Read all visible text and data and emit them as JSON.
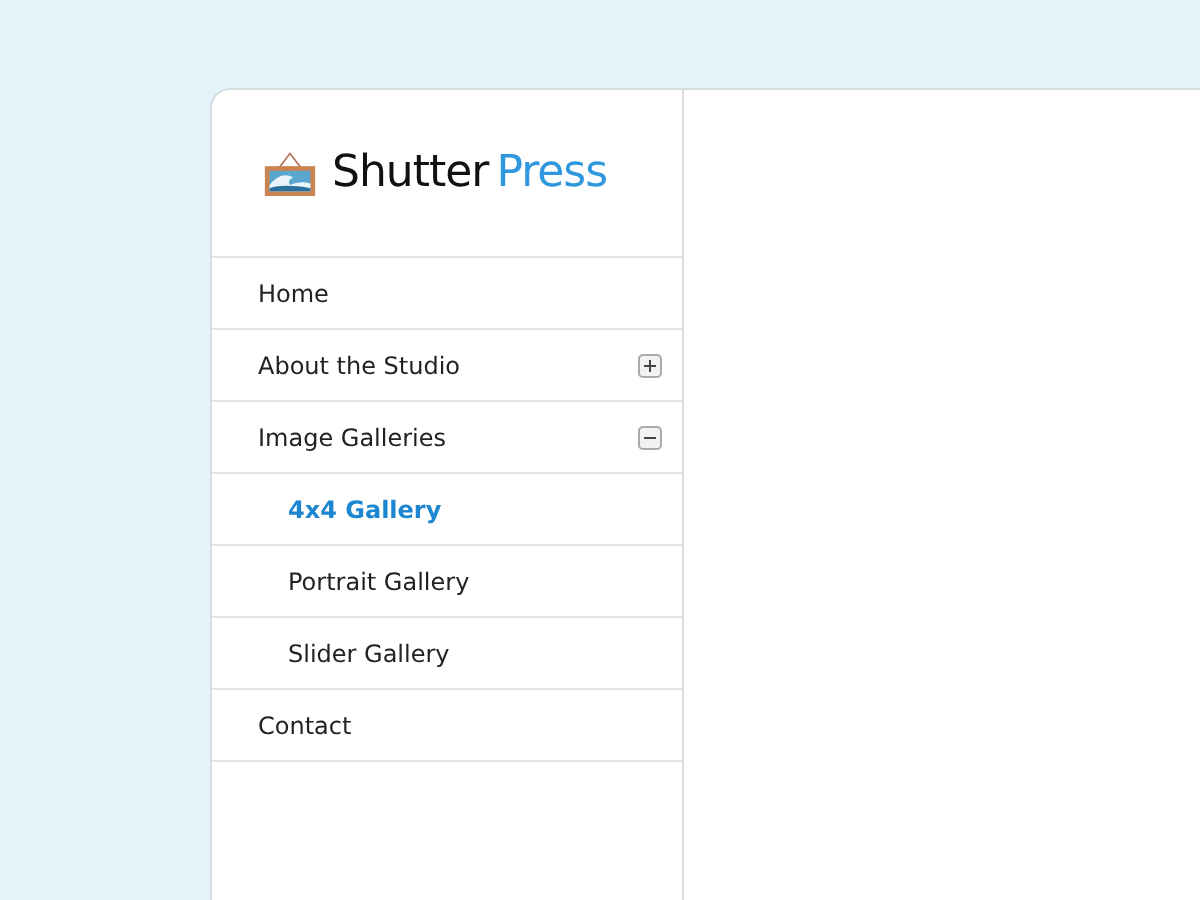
{
  "logo": {
    "primary": "Shutter",
    "secondary": "Press"
  },
  "nav": [
    {
      "label": "Home",
      "selected": false
    },
    {
      "label": "About the Studio",
      "selected": false,
      "expanded": false
    },
    {
      "label": "Image Galleries",
      "selected": false,
      "expanded": true,
      "children": [
        {
          "label": "4x4 Gallery",
          "selected": true
        },
        {
          "label": "Portrait Gallery",
          "selected": false
        },
        {
          "label": "Slider Gallery",
          "selected": false
        }
      ]
    },
    {
      "label": "Contact",
      "selected": false
    }
  ]
}
